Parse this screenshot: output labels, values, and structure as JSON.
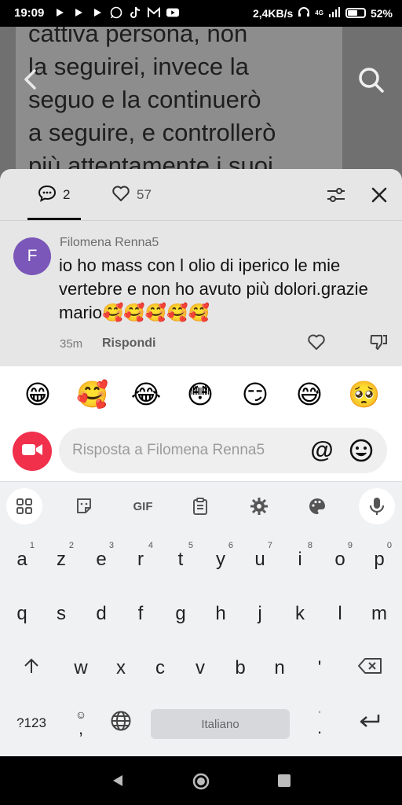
{
  "status_bar": {
    "time": "19:09",
    "network_speed": "2,4KB/s",
    "signal_label": "4G",
    "battery": "52%",
    "notification_icons": [
      "play-icon",
      "play-icon",
      "play-icon",
      "whatsapp-icon",
      "tiktok-icon",
      "gmail-icon",
      "youtube-icon"
    ]
  },
  "video": {
    "text_lines": [
      "cattiva persona, non",
      "la seguirei, invece la",
      "seguo e la continuerò",
      "a seguire, e controllerò",
      "più attentamente i suoi"
    ]
  },
  "comments_sheet": {
    "comments_count": "2",
    "likes_count": "57",
    "comment": {
      "avatar_letter": "F",
      "author": "Filomena Renna5",
      "text": "io ho mass con l olio di iperico le mie vertebre e non ho avuto più dolori.grazie mario🥰🥰🥰🥰🥰",
      "time": "35m",
      "reply_label": "Rispondi"
    }
  },
  "reply_panel": {
    "emojis": [
      "😁",
      "🥰",
      "😂",
      "😳",
      "😏",
      "😅",
      "🥺"
    ],
    "placeholder": "Risposta a Filomena Renna5",
    "at_symbol": "@"
  },
  "keyboard": {
    "toolbar": [
      "apps-icon",
      "sticker-icon",
      "GIF",
      "clipboard-icon",
      "settings-icon",
      "theme-icon",
      "mic-icon"
    ],
    "gif_label": "GIF",
    "row1": [
      {
        "key": "a",
        "hint": "1"
      },
      {
        "key": "z",
        "hint": "2"
      },
      {
        "key": "e",
        "hint": "3"
      },
      {
        "key": "r",
        "hint": "4"
      },
      {
        "key": "t",
        "hint": "5"
      },
      {
        "key": "y",
        "hint": "6"
      },
      {
        "key": "u",
        "hint": "7"
      },
      {
        "key": "i",
        "hint": "8"
      },
      {
        "key": "o",
        "hint": "9"
      },
      {
        "key": "p",
        "hint": "0"
      }
    ],
    "row2": [
      "q",
      "s",
      "d",
      "f",
      "g",
      "h",
      "j",
      "k",
      "l",
      "m"
    ],
    "row3": [
      "w",
      "x",
      "c",
      "v",
      "b",
      "n",
      "'"
    ],
    "symbols_label": "?123",
    "comma_label": ",",
    "period_label": ".",
    "emoji_key_label": "☺",
    "space_label": "Italiano"
  }
}
